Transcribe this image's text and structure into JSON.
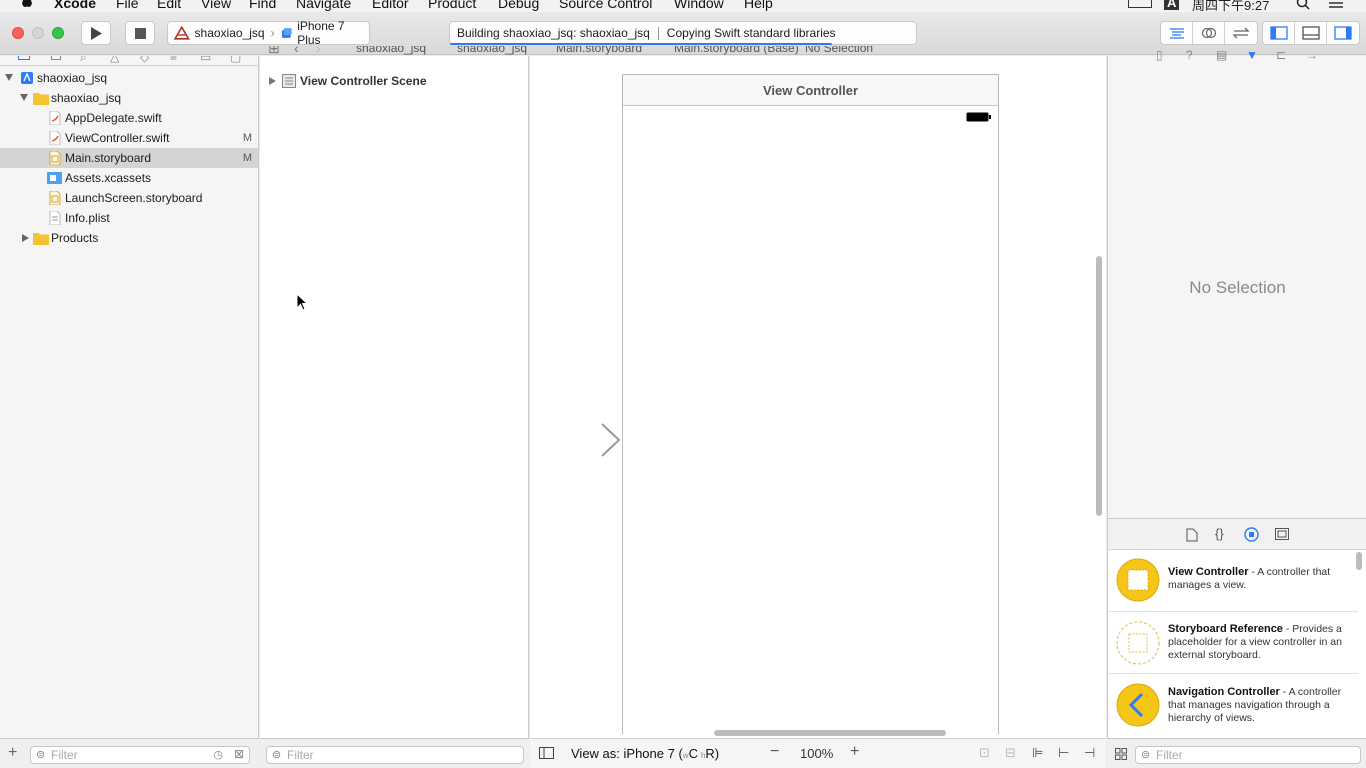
{
  "menubar": {
    "app": "Xcode",
    "items": [
      "File",
      "Edit",
      "View",
      "Find",
      "Navigate",
      "Editor",
      "Product",
      "Debug",
      "Source Control",
      "Window",
      "Help"
    ],
    "clock": "周四下午9:27",
    "input_method": "A"
  },
  "toolbar": {
    "scheme": "shaoxiao_jsq",
    "device": "iPhone 7 Plus",
    "activity_building": "Building shaoxiao_jsq: shaoxiao_jsq",
    "activity_step": "Copying Swift standard libraries",
    "build_progress": 0.82
  },
  "navigator": {
    "items": [
      {
        "label": "shaoxiao_jsq",
        "badge": ""
      },
      {
        "label": "shaoxiao_jsq",
        "badge": ""
      },
      {
        "label": "AppDelegate.swift",
        "badge": ""
      },
      {
        "label": "ViewController.swift",
        "badge": "M"
      },
      {
        "label": "Main.storyboard",
        "badge": "M"
      },
      {
        "label": "Assets.xcassets",
        "badge": ""
      },
      {
        "label": "LaunchScreen.storyboard",
        "badge": ""
      },
      {
        "label": "Info.plist",
        "badge": ""
      },
      {
        "label": "Products",
        "badge": ""
      }
    ],
    "filter_placeholder": "Filter"
  },
  "jumpbar": {
    "crumbs": [
      "shaoxiao_jsq",
      "shaoxiao_jsq",
      "Main.storyboard",
      "Main.storyboard (Base)",
      "No Selection"
    ]
  },
  "outline": {
    "scene": "View Controller Scene",
    "filter_placeholder": "Filter"
  },
  "canvas": {
    "scene_title": "View Controller",
    "view_as_prefix": "View as: iPhone 7 (",
    "view_as_w": "w",
    "view_as_c": "C",
    "view_as_h": "h",
    "view_as_r": "R)",
    "zoom": "100%"
  },
  "inspector": {
    "no_selection": "No Selection"
  },
  "library": {
    "items": [
      {
        "title": "View Controller",
        "desc": " - A controller that manages a view."
      },
      {
        "title": "Storyboard Reference",
        "desc": " - Provides a placeholder for a view controller in an external storyboard."
      },
      {
        "title": "Navigation Controller",
        "desc": " - A controller that manages navigation through a hierarchy of views."
      }
    ],
    "filter_placeholder": "Filter"
  },
  "colors": {
    "accent": "#2d7cf6",
    "folder": "#f4c430",
    "close": "#fc605c",
    "minimize": "#d6d6d6",
    "zoom": "#34c84a"
  }
}
